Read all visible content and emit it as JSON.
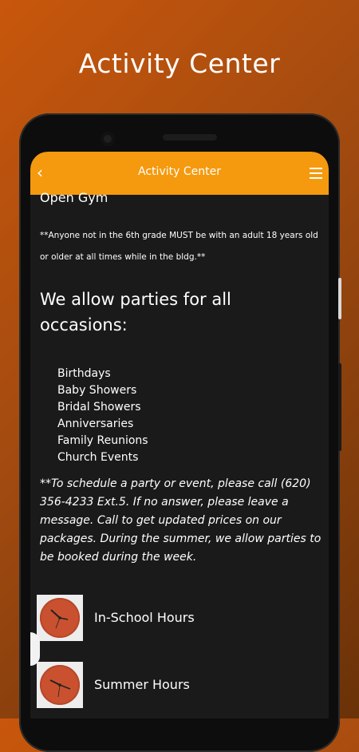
{
  "promo": {
    "title": "Activity Center"
  },
  "appbar": {
    "title": "Activity Center",
    "back_icon": "chevron-left-icon",
    "menu_icon": "hamburger-menu-icon"
  },
  "content": {
    "section_heading": "Open Gym",
    "note": "**Anyone not in the 6th grade MUST be with an adult 18 years old or older at all times while in the bldg.**",
    "parties_heading": "We allow parties for all occasions:",
    "party_types": [
      "Birthdays",
      "Baby Showers",
      "Bridal Showers",
      "Anniversaries",
      "Family Reunions",
      "Church Events"
    ],
    "schedule_note": "**To schedule a party or event, please call (620) 356-4233 Ext.5. If no answer, please leave a message. Call to get updated prices on our packages. During the summer, we allow parties to be booked during the week."
  },
  "cards": [
    {
      "label": "In-School Hours",
      "icon": "clock-icon"
    },
    {
      "label": "Summer Hours",
      "icon": "clock-icon"
    }
  ],
  "colors": {
    "accent": "#f59a0e",
    "background": "#1a1a1a",
    "clock": "#c9512f"
  }
}
